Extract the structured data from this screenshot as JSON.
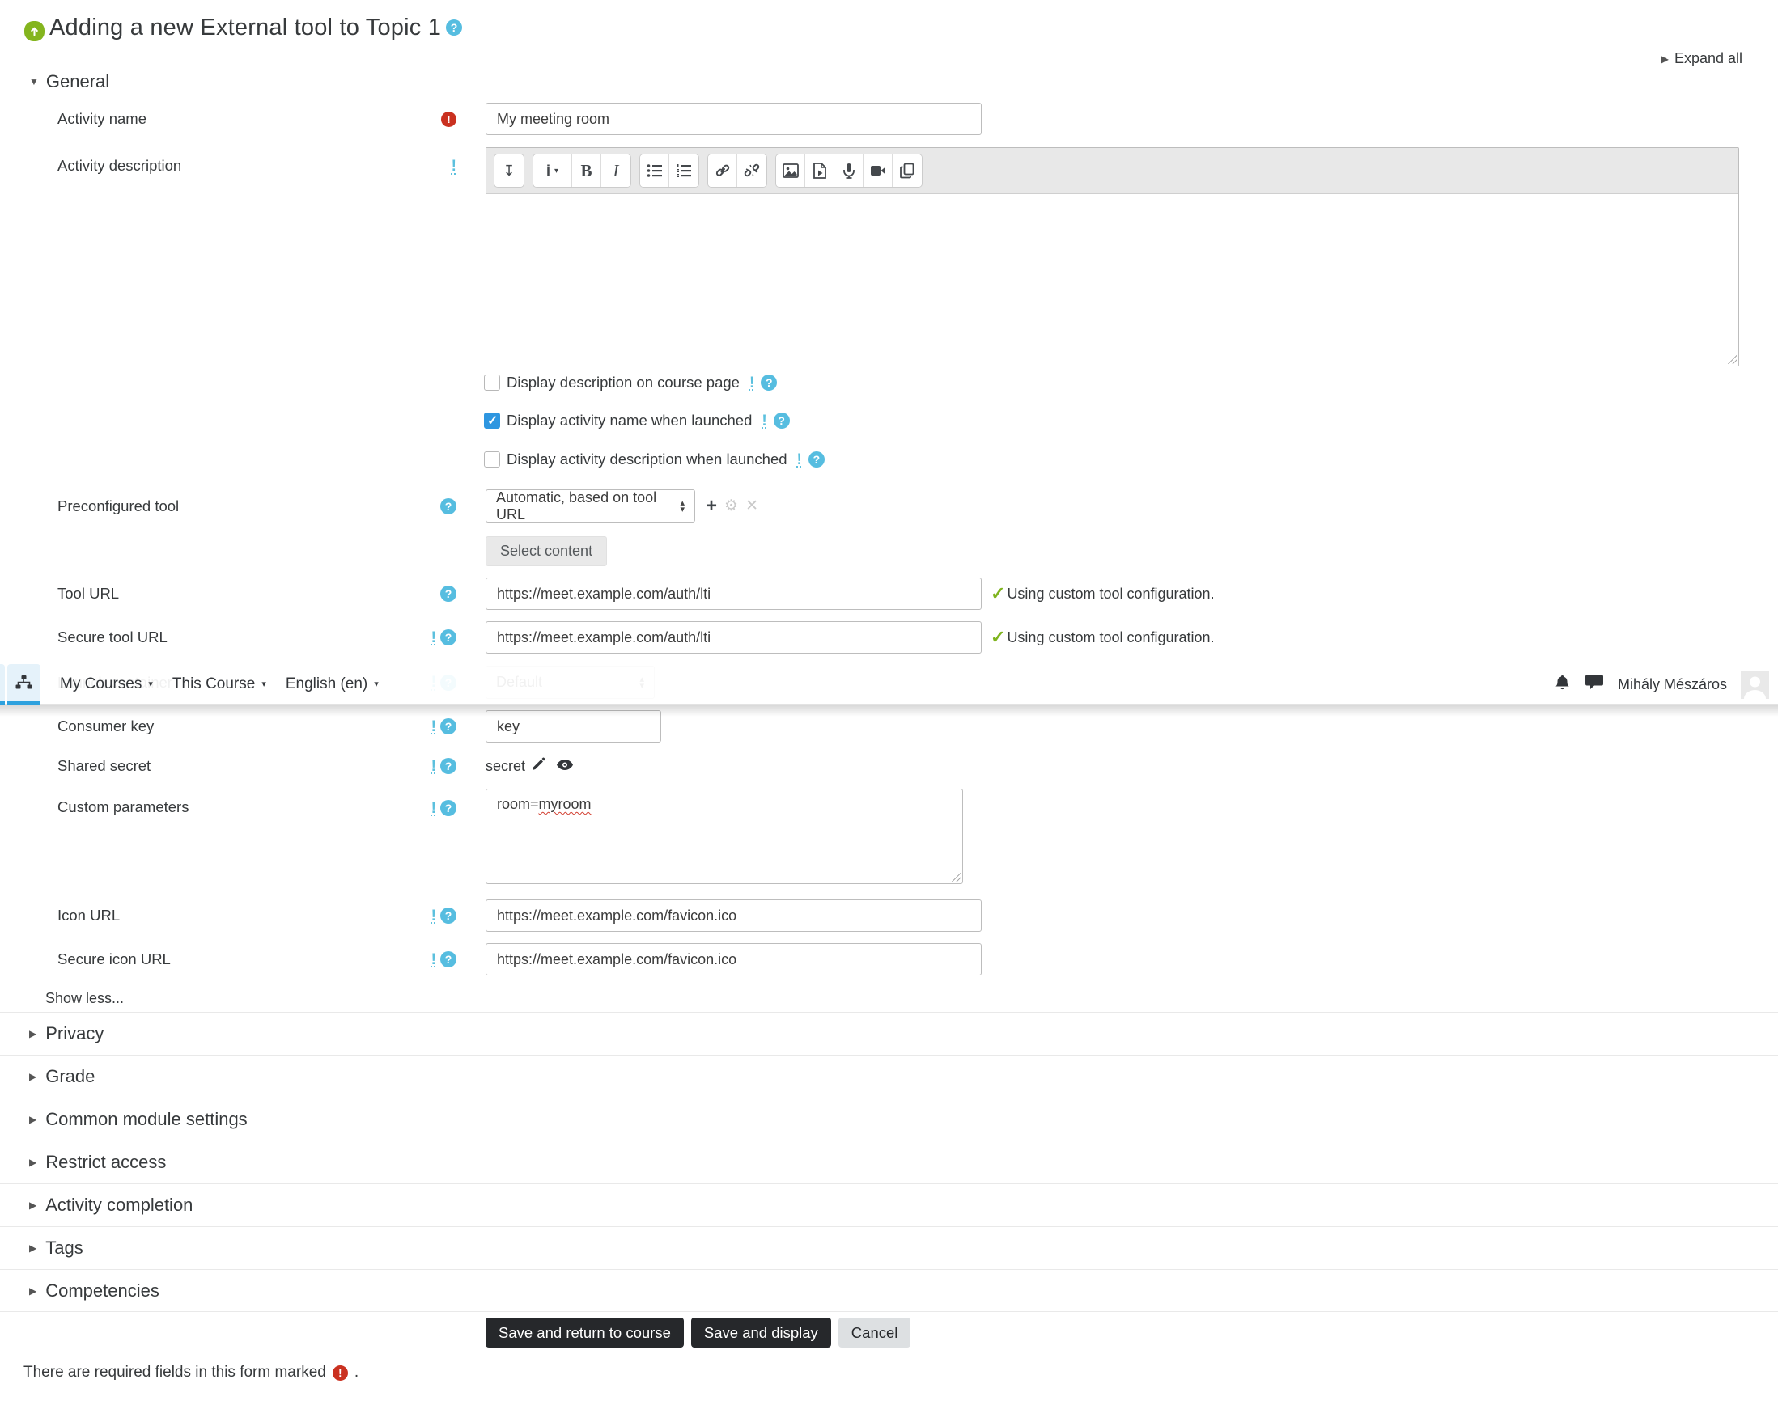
{
  "header": {
    "title": "Adding a new External tool to Topic 1",
    "expand_all": "Expand all"
  },
  "navbar": {
    "items": [
      {
        "label": "My Courses"
      },
      {
        "label": "This Course"
      },
      {
        "label": "English (en)"
      }
    ],
    "user_name": "Mihály Mészáros",
    "icons": [
      "sitemap-icon",
      "bell-icon",
      "chat-icon",
      "avatar"
    ]
  },
  "sections": {
    "general": "General",
    "collapsed": [
      "Privacy",
      "Grade",
      "Common module settings",
      "Restrict access",
      "Activity completion",
      "Tags",
      "Competencies"
    ]
  },
  "fields": {
    "activity_name": {
      "label": "Activity name",
      "value": "My meeting room"
    },
    "activity_description": {
      "label": "Activity description"
    },
    "checkboxes": [
      {
        "label": "Display description on course page",
        "checked": false
      },
      {
        "label": "Display activity name when launched",
        "checked": true
      },
      {
        "label": "Display activity description when launched",
        "checked": false
      }
    ],
    "preconfigured_tool": {
      "label": "Preconfigured tool",
      "value": "Automatic, based on tool URL",
      "button": "Select content"
    },
    "tool_url": {
      "label": "Tool URL",
      "value": "https://meet.example.com/auth/lti",
      "status": "Using custom tool configuration."
    },
    "secure_tool_url": {
      "label": "Secure tool URL",
      "value": "https://meet.example.com/auth/lti",
      "status": "Using custom tool configuration."
    },
    "launch_container": {
      "label": "Launch container",
      "value": "Default"
    },
    "consumer_key": {
      "label": "Consumer key",
      "value": "key"
    },
    "shared_secret": {
      "label": "Shared secret",
      "value": "secret"
    },
    "custom_parameters": {
      "label": "Custom parameters",
      "value": "room=myroom",
      "prefix": "room=",
      "misspelled": "myroom"
    },
    "icon_url": {
      "label": "Icon URL",
      "value": "https://meet.example.com/favicon.ico"
    },
    "secure_icon_url": {
      "label": "Secure icon URL",
      "value": "https://meet.example.com/favicon.ico"
    }
  },
  "editor": {
    "toolbar_icons": [
      "collapse-toolbar-icon",
      "paragraph-style-icon",
      "bold-icon",
      "italic-icon",
      "bullet-list-icon",
      "ordered-list-icon",
      "link-icon",
      "unlink-icon",
      "image-icon",
      "media-icon",
      "record-audio-icon",
      "record-video-icon",
      "manage-files-icon"
    ]
  },
  "misc": {
    "show_less": "Show less...",
    "bold_glyph": "B",
    "italic_glyph": "I",
    "style_glyph": "i"
  },
  "actions": {
    "save_return": "Save and return to course",
    "save_display": "Save and display",
    "cancel": "Cancel"
  },
  "footer": {
    "required_note": "There are required fields in this form marked",
    "note_suffix": "."
  },
  "colors": {
    "accent_blue": "#2ea1de",
    "help_blue": "#5bc0de",
    "required_red": "#ca3120",
    "check_green": "#7eb41d",
    "button_dark": "#26282b",
    "checkbox_blue": "#2e96e0",
    "lti_green": "#84b51e"
  }
}
